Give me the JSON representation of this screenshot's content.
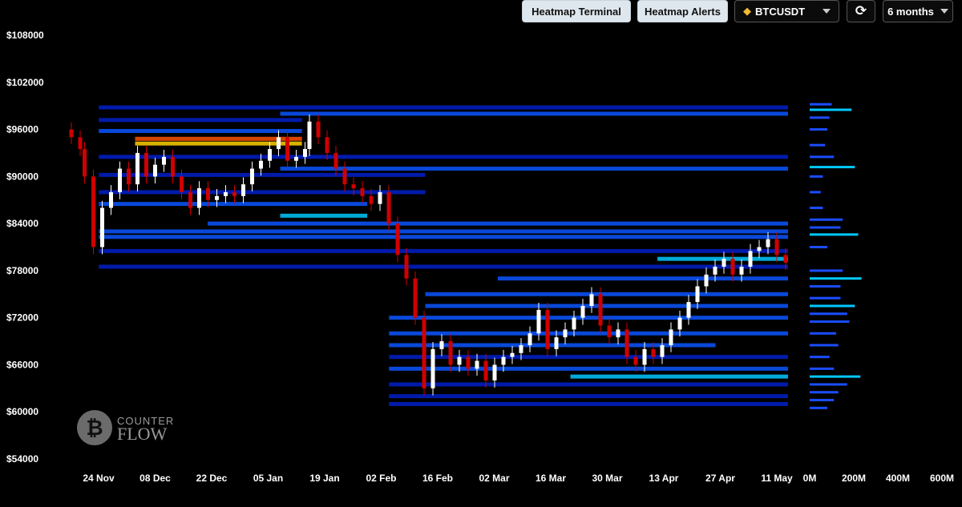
{
  "toolbar": {
    "terminal_label": "Heatmap Terminal",
    "alerts_label": "Heatmap Alerts",
    "symbol_label": "BTCUSDT",
    "timeframe_label": "6 months"
  },
  "logo": {
    "line1": "COUNTER",
    "line2": "FLOW"
  },
  "colors": {
    "up": "#ffffff",
    "down": "#d00000",
    "heat_low": "#0020c8",
    "heat_mid": "#00c8ff",
    "heat_high": "#ffd000",
    "heat_max": "#ff5000"
  },
  "chart_data": {
    "type": "heatmap",
    "y_ticks": [
      "$108000",
      "$102000",
      "$96000",
      "$90000",
      "$84000",
      "$78000",
      "$72000",
      "$66000",
      "$60000",
      "$54000"
    ],
    "ylim": [
      54000,
      108000
    ],
    "x_ticks": [
      "24 Nov",
      "08 Dec",
      "22 Dec",
      "05 Jan",
      "19 Jan",
      "02 Feb",
      "16 Feb",
      "02 Mar",
      "16 Mar",
      "30 Mar",
      "13 Apr",
      "27 Apr",
      "11 May"
    ],
    "volume_ticks": [
      "0M",
      "200M",
      "400M",
      "600M"
    ],
    "volume_lim": [
      0,
      600
    ],
    "price_path": [
      [
        0,
        96000
      ],
      [
        2,
        95000
      ],
      [
        4,
        93500
      ],
      [
        5,
        90000
      ],
      [
        7,
        81000
      ],
      [
        9,
        86000
      ],
      [
        11,
        88000
      ],
      [
        13,
        91000
      ],
      [
        15,
        89000
      ],
      [
        17,
        93000
      ],
      [
        19,
        90000
      ],
      [
        21,
        91500
      ],
      [
        23,
        92500
      ],
      [
        25,
        90000
      ],
      [
        27,
        88000
      ],
      [
        29,
        86000
      ],
      [
        31,
        88500
      ],
      [
        33,
        87000
      ],
      [
        35,
        87500
      ],
      [
        37,
        88000
      ],
      [
        39,
        87500
      ],
      [
        41,
        89000
      ],
      [
        43,
        91000
      ],
      [
        45,
        92000
      ],
      [
        47,
        93500
      ],
      [
        49,
        95000
      ],
      [
        51,
        92000
      ],
      [
        53,
        92500
      ],
      [
        55,
        93500
      ],
      [
        56,
        97000
      ],
      [
        58,
        95000
      ],
      [
        60,
        93000
      ],
      [
        62,
        91000
      ],
      [
        64,
        89000
      ],
      [
        66,
        88500
      ],
      [
        68,
        87500
      ],
      [
        70,
        86500
      ],
      [
        72,
        88000
      ],
      [
        74,
        84000
      ],
      [
        76,
        80000
      ],
      [
        78,
        77000
      ],
      [
        80,
        72000
      ],
      [
        82,
        63000
      ],
      [
        84,
        68000
      ],
      [
        86,
        69000
      ],
      [
        88,
        66000
      ],
      [
        90,
        67000
      ],
      [
        92,
        65500
      ],
      [
        94,
        66500
      ],
      [
        96,
        64000
      ],
      [
        98,
        66000
      ],
      [
        100,
        67000
      ],
      [
        102,
        67500
      ],
      [
        104,
        68500
      ],
      [
        106,
        70000
      ],
      [
        108,
        73000
      ],
      [
        110,
        68000
      ],
      [
        112,
        69500
      ],
      [
        114,
        70500
      ],
      [
        116,
        72000
      ],
      [
        118,
        73500
      ],
      [
        120,
        75000
      ],
      [
        122,
        71000
      ],
      [
        124,
        69500
      ],
      [
        126,
        70500
      ],
      [
        128,
        67000
      ],
      [
        130,
        66000
      ],
      [
        132,
        68000
      ],
      [
        134,
        67000
      ],
      [
        136,
        68500
      ],
      [
        138,
        70500
      ],
      [
        140,
        72000
      ],
      [
        142,
        74000
      ],
      [
        144,
        76000
      ],
      [
        146,
        77500
      ],
      [
        148,
        78500
      ],
      [
        150,
        79500
      ],
      [
        152,
        77500
      ],
      [
        154,
        78500
      ],
      [
        156,
        80500
      ],
      [
        158,
        81000
      ],
      [
        160,
        82000
      ],
      [
        162,
        80000
      ],
      [
        164,
        79000
      ]
    ],
    "heat_bands": [
      {
        "price": 98800,
        "from": 0.05,
        "to": 1.0,
        "level": 0.2
      },
      {
        "price": 98000,
        "from": 0.3,
        "to": 1.0,
        "level": 0.3
      },
      {
        "price": 97200,
        "from": 0.05,
        "to": 0.33,
        "level": 0.25
      },
      {
        "price": 95800,
        "from": 0.05,
        "to": 0.33,
        "level": 0.35
      },
      {
        "price": 94800,
        "from": 0.1,
        "to": 0.33,
        "level": 1.0
      },
      {
        "price": 94200,
        "from": 0.1,
        "to": 0.33,
        "level": 0.9
      },
      {
        "price": 92500,
        "from": 0.05,
        "to": 1.0,
        "level": 0.25
      },
      {
        "price": 91000,
        "from": 0.3,
        "to": 1.0,
        "level": 0.35
      },
      {
        "price": 90200,
        "from": 0.05,
        "to": 0.5,
        "level": 0.2
      },
      {
        "price": 88000,
        "from": 0.05,
        "to": 0.5,
        "level": 0.25
      },
      {
        "price": 86500,
        "from": 0.05,
        "to": 0.42,
        "level": 0.3
      },
      {
        "price": 85000,
        "from": 0.3,
        "to": 0.42,
        "level": 0.7
      },
      {
        "price": 84000,
        "from": 0.2,
        "to": 1.0,
        "level": 0.35
      },
      {
        "price": 83000,
        "from": 0.05,
        "to": 1.0,
        "level": 0.3
      },
      {
        "price": 82300,
        "from": 0.05,
        "to": 1.0,
        "level": 0.45
      },
      {
        "price": 80500,
        "from": 0.05,
        "to": 1.0,
        "level": 0.2
      },
      {
        "price": 79500,
        "from": 0.82,
        "to": 1.0,
        "level": 0.55
      },
      {
        "price": 78500,
        "from": 0.05,
        "to": 1.0,
        "level": 0.2
      },
      {
        "price": 77000,
        "from": 0.6,
        "to": 1.0,
        "level": 0.3
      },
      {
        "price": 75000,
        "from": 0.5,
        "to": 1.0,
        "level": 0.3
      },
      {
        "price": 73500,
        "from": 0.5,
        "to": 1.0,
        "level": 0.35
      },
      {
        "price": 72000,
        "from": 0.45,
        "to": 1.0,
        "level": 0.3
      },
      {
        "price": 70000,
        "from": 0.45,
        "to": 1.0,
        "level": 0.35
      },
      {
        "price": 68500,
        "from": 0.45,
        "to": 0.9,
        "level": 0.3
      },
      {
        "price": 67000,
        "from": 0.45,
        "to": 1.0,
        "level": 0.25
      },
      {
        "price": 65500,
        "from": 0.45,
        "to": 1.0,
        "level": 0.3
      },
      {
        "price": 64500,
        "from": 0.7,
        "to": 1.0,
        "level": 0.5
      },
      {
        "price": 63500,
        "from": 0.45,
        "to": 1.0,
        "level": 0.25
      },
      {
        "price": 62000,
        "from": 0.45,
        "to": 1.0,
        "level": 0.25
      },
      {
        "price": 61000,
        "from": 0.45,
        "to": 1.0,
        "level": 0.2
      }
    ],
    "volume_profile": [
      {
        "price": 99200,
        "volume": 100
      },
      {
        "price": 98500,
        "volume": 190
      },
      {
        "price": 97500,
        "volume": 90
      },
      {
        "price": 96000,
        "volume": 80
      },
      {
        "price": 94000,
        "volume": 70
      },
      {
        "price": 92500,
        "volume": 110
      },
      {
        "price": 91200,
        "volume": 205
      },
      {
        "price": 90000,
        "volume": 60
      },
      {
        "price": 88000,
        "volume": 50
      },
      {
        "price": 86000,
        "volume": 60
      },
      {
        "price": 84500,
        "volume": 150
      },
      {
        "price": 83500,
        "volume": 140
      },
      {
        "price": 82600,
        "volume": 220
      },
      {
        "price": 81000,
        "volume": 80
      },
      {
        "price": 78000,
        "volume": 150
      },
      {
        "price": 77000,
        "volume": 235
      },
      {
        "price": 76000,
        "volume": 140
      },
      {
        "price": 74500,
        "volume": 140
      },
      {
        "price": 73500,
        "volume": 205
      },
      {
        "price": 72500,
        "volume": 170
      },
      {
        "price": 71500,
        "volume": 180
      },
      {
        "price": 70000,
        "volume": 120
      },
      {
        "price": 68500,
        "volume": 130
      },
      {
        "price": 67000,
        "volume": 90
      },
      {
        "price": 65500,
        "volume": 110
      },
      {
        "price": 64500,
        "volume": 230
      },
      {
        "price": 63500,
        "volume": 170
      },
      {
        "price": 62500,
        "volume": 130
      },
      {
        "price": 61500,
        "volume": 110
      },
      {
        "price": 60500,
        "volume": 80
      }
    ]
  }
}
